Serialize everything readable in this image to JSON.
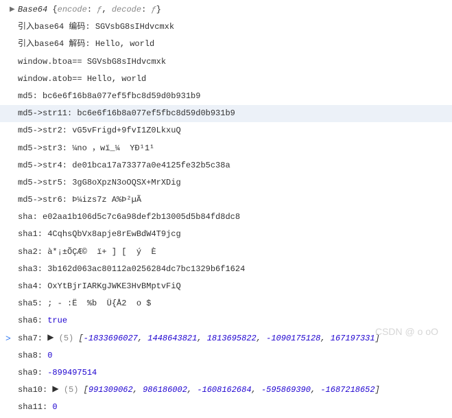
{
  "rows": [
    {
      "arrow": "▶",
      "k": "",
      "v": "Base64 {encode: ƒ, decode: ƒ}",
      "type": "obj"
    },
    {
      "k": "引入base64 编码:",
      "v": " SGVsbG8sIHdvcmxk",
      "type": "text"
    },
    {
      "k": "引入base64 解码:",
      "v": " Hello, world",
      "type": "text"
    },
    {
      "k": "window.btoa==",
      "v": " SGVsbG8sIHdvcmxk",
      "type": "text"
    },
    {
      "k": "window.atob==",
      "v": " Hello, world",
      "type": "text"
    },
    {
      "k": "md5:",
      "v": " bc6e6f16b8a077ef5fbc8d59d0b931b9",
      "type": "text"
    },
    {
      "k": "md5->str11:",
      "v": " bc6e6f16b8a077ef5fbc8d59d0b931b9",
      "type": "text",
      "highlight": true
    },
    {
      "k": "md5->str2:",
      "v": " vG5vFrigd+9fvI1Z0LkxuQ",
      "type": "text"
    },
    {
      "k": "md5->str3:",
      "v": " ¼no ，wï_¼  YĐ¹1¹",
      "type": "text"
    },
    {
      "k": "md5->str4:",
      "v": " de01bca17a73377a0e4125fe32b5c38a",
      "type": "text"
    },
    {
      "k": "md5->str5:",
      "v": " 3gG8oXpzN3oOQSX+MrXDig",
      "type": "text"
    },
    {
      "k": "md5->str6:",
      "v": " Þ¼izs7z A%Þ²µÃ",
      "type": "text"
    },
    {
      "k": "sha:",
      "v": " e02aa1b106d5c7c6a98def2b13005d5b84fd8dc8",
      "type": "text"
    },
    {
      "k": "sha1:",
      "v": " 4CqhsQbVx8apje8rEwBdW4T9jcg",
      "type": "text"
    },
    {
      "k": "sha2:",
      "v": " à*¡±ÕÇÆ©  ï+ ] [  ý  È",
      "type": "text"
    },
    {
      "k": "sha3:",
      "v": " 3b162d063ac80112a0256284dc7bc1329b6f1624",
      "type": "text"
    },
    {
      "k": "sha4:",
      "v": " OxYtBjrIARKgJWKE3HvBMptvFiQ",
      "type": "text"
    },
    {
      "k": "sha5:",
      "v": " ; - :Ë  %b  Ü{Å2  o $",
      "type": "text"
    },
    {
      "k": "sha6:",
      "v": "true",
      "type": "bool"
    },
    {
      "k": "sha7:",
      "arrow_inline": "▶",
      "count": "(5)",
      "v": "[-1833696027, 1448643821, 1813695822, -1090175128, 167197331]",
      "type": "arr"
    },
    {
      "k": "sha8:",
      "v": "0",
      "type": "num"
    },
    {
      "k": "sha9:",
      "v": "-899497514",
      "type": "num"
    },
    {
      "k": "sha10:",
      "arrow_inline": "▶",
      "count": "(5)",
      "v": "[991309062, 986186002, -1608162684, -595869390, -1687218652]",
      "type": "arr"
    },
    {
      "k": "sha11:",
      "v": "0",
      "type": "num"
    }
  ],
  "watermark": "CSDN @ o oO",
  "prompt": ">"
}
